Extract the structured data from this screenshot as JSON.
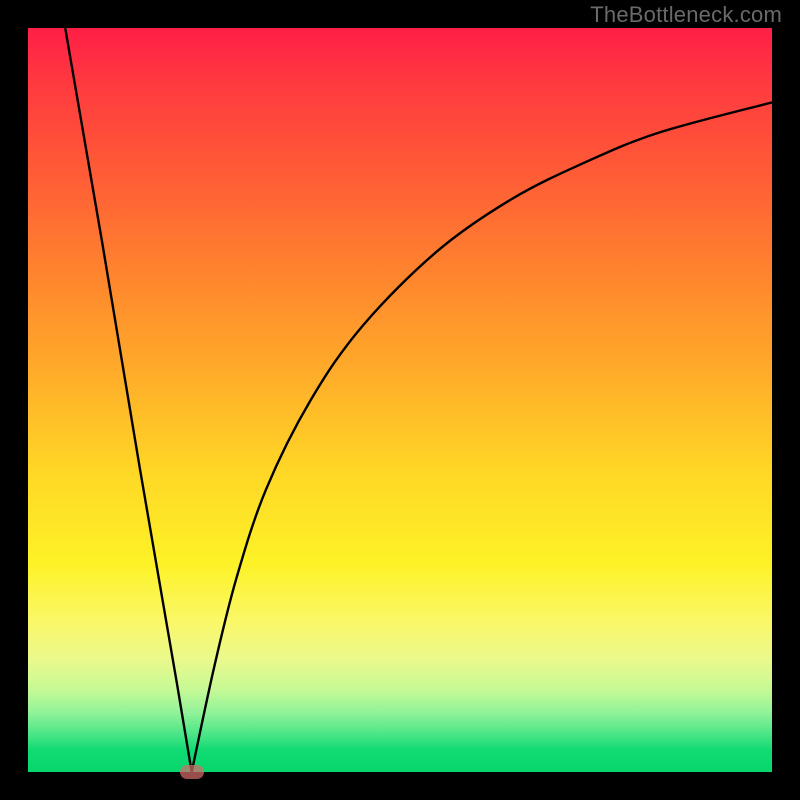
{
  "attribution": "TheBottleneck.com",
  "colors": {
    "page_bg": "#000000",
    "curve": "#000000",
    "marker": "#d66b6b",
    "gradient_top": "#ff1f47",
    "gradient_bottom": "#06d76b"
  },
  "chart_data": {
    "type": "line",
    "title": "",
    "xlabel": "",
    "ylabel": "",
    "xlim": [
      0,
      100
    ],
    "ylim": [
      0,
      100
    ],
    "grid": false,
    "legend": false,
    "description": "V-shaped bottleneck curve. Left branch is steep/linear descending from top-left to the minimum near x≈22. Right branch rises from the minimum with decreasing slope toward the top-right, ending around y≈90 at x=100. Background is a vertical red→yellow→green gradient (worse→better). A small pink marker sits at the minimum.",
    "series": [
      {
        "name": "left-branch",
        "x": [
          5,
          10,
          15,
          20,
          22
        ],
        "values": [
          100,
          71,
          41,
          12,
          0
        ]
      },
      {
        "name": "right-branch",
        "x": [
          22,
          25,
          28,
          32,
          38,
          45,
          55,
          65,
          75,
          85,
          100
        ],
        "values": [
          0,
          14,
          26,
          38,
          50,
          60,
          70,
          77,
          82,
          86,
          90
        ]
      }
    ],
    "marker": {
      "x": 22,
      "y": 0
    }
  }
}
